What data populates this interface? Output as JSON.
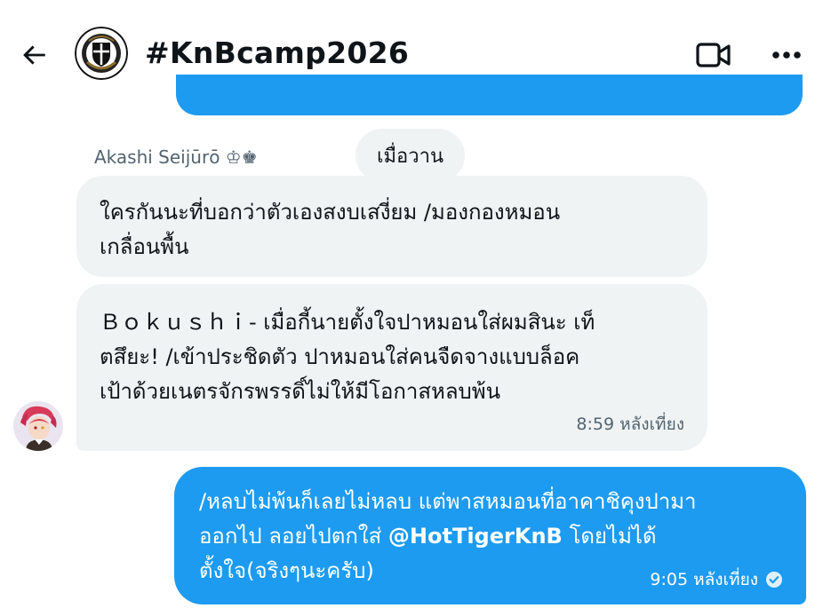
{
  "header": {
    "title": "#KnBcamp2026"
  },
  "thread": {
    "day_divider": "เมื่อวาน",
    "sender": {
      "name": "Akashi Seijūrō",
      "name_suffix": "♔♚"
    },
    "messages_in": [
      {
        "text_lines": [
          "ใครกันนะที่บอกว่าตัวเองสงบเสงี่ยม /มองกองหมอน",
          "เกลื่อนพื้น"
        ]
      },
      {
        "text_lines": [
          "Ｂｏｋｕｓｈｉ- เมื่อกี้นายตั้งใจปาหมอนใส่ผมสินะ เท็",
          "ตสึยะ! /เข้าประชิดตัว ปาหมอนใส่คนจืดจางแบบล็อค",
          "เป้าด้วยเนตรจักรพรรดิ์ไม่ให้มีโอกาสหลบพ้น"
        ],
        "time": "8:59 หลังเที่ยง"
      }
    ],
    "message_out": {
      "line1": "/หลบไม่พ้นก็เลยไม่หลบ แต่พาสหมอนที่อาคาชิคุงปามา",
      "line2_before": "ออกไป ลอยไปตกใส่ ",
      "mention": "@HotTigerKnB",
      "line2_after": " โดยไม่ได้",
      "line3": "ตั้งใจ(จริงๆนะครับ)",
      "time": "9:05 หลังเที่ยง",
      "status": "sent"
    }
  },
  "colors": {
    "accent": "#1d9bf0",
    "bubble_in": "#eff3f4",
    "muted_text": "#536471"
  }
}
